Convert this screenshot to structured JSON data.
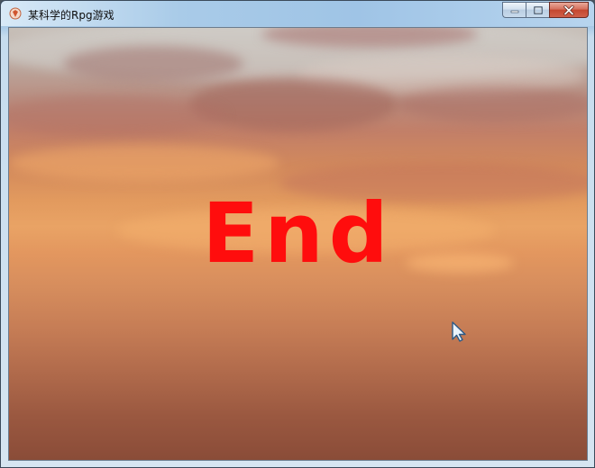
{
  "window": {
    "title": "某科学的Rpg游戏",
    "app_icon": "game-app-icon",
    "controls": {
      "minimize_icon": "minimize-icon",
      "maximize_icon": "maximize-icon",
      "close_icon": "close-icon"
    }
  },
  "scene": {
    "message": "End",
    "message_color": "#ff0d0d",
    "background": "sunset-sky",
    "cursor_icon": "mouse-pointer-icon"
  }
}
